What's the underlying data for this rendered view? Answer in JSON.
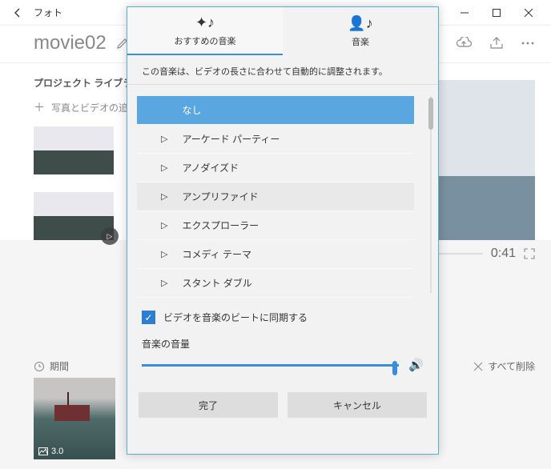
{
  "app_title": "フォト",
  "project_name": "movie02",
  "section_library": "プロジェクト ライブラリ",
  "add_media_label": "写真とビデオの追加",
  "time_total": "0:41",
  "timeline": {
    "duration_label": "期間",
    "clear_label": "すべて削除",
    "clip_overlay": "3.0"
  },
  "dialog": {
    "tab_recommended": "おすすめの音楽",
    "tab_music": "音楽",
    "hint": "この音楽は、ビデオの長さに合わせて自動的に調整されます。",
    "items": [
      {
        "label": "なし",
        "selected": true
      },
      {
        "label": "アーケード パーティー"
      },
      {
        "label": "アノダイズド"
      },
      {
        "label": "アンプリファイド",
        "hover": true
      },
      {
        "label": "エクスプローラー"
      },
      {
        "label": "コメディ テーマ"
      },
      {
        "label": "スタント ダブル"
      }
    ],
    "sync_label": "ビデオを音楽のビートに同期する",
    "volume_label": "音楽の音量",
    "btn_done": "完了",
    "btn_cancel": "キャンセル"
  }
}
